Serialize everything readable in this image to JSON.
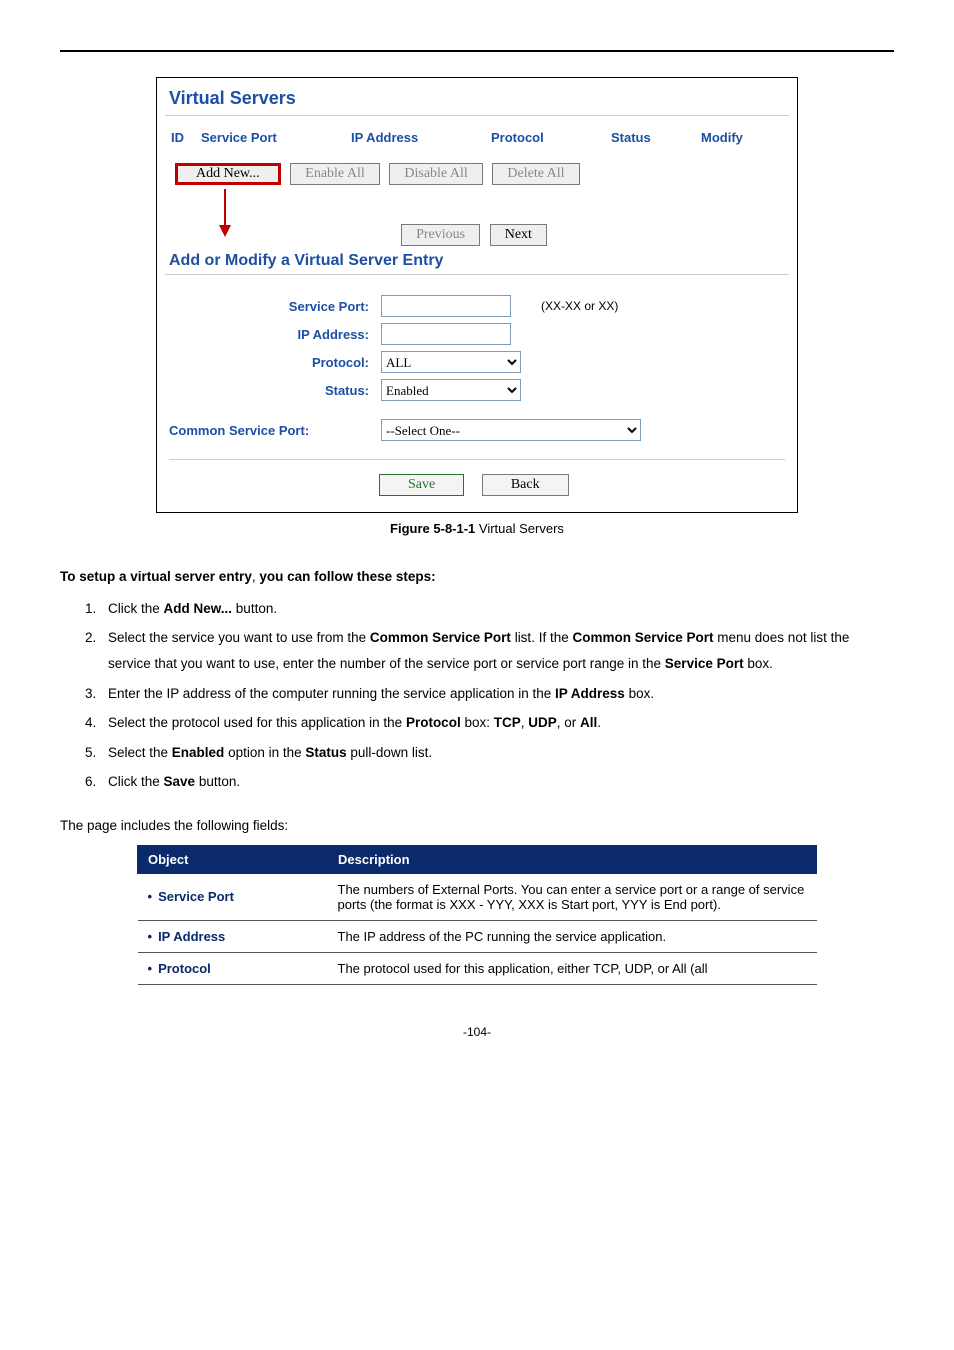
{
  "panel": {
    "title": "Virtual Servers",
    "columns": {
      "id": "ID",
      "service_port": "Service Port",
      "ip_address": "IP Address",
      "protocol": "Protocol",
      "status": "Status",
      "modify": "Modify"
    },
    "buttons": {
      "add_new": "Add New...",
      "enable_all": "Enable All",
      "disable_all": "Disable All",
      "delete_all": "Delete All",
      "previous": "Previous",
      "next": "Next"
    },
    "subheader": "Add or Modify a Virtual Server Entry",
    "form": {
      "service_port_label": "Service Port:",
      "service_port_hint": "(XX-XX or XX)",
      "ip_address_label": "IP Address:",
      "protocol_label": "Protocol:",
      "protocol_value": "ALL",
      "status_label": "Status:",
      "status_value": "Enabled",
      "csp_label": "Common Service Port:",
      "csp_value": "--Select One--",
      "save": "Save",
      "back": "Back"
    }
  },
  "caption": {
    "label": "Figure 5-8-1-1",
    "text": " Virtual Servers"
  },
  "intro": {
    "lead": "To setup a virtual server entry",
    "rest": ", you can follow these steps:"
  },
  "steps": [
    {
      "pre": "Click the ",
      "b1": "Add New...",
      "post": " button."
    },
    {
      "pre": "Select the service you want to use from the ",
      "b1": "Common Service Port",
      "mid": " list. If the ",
      "b2": "Common Service Port",
      "mid2": " menu does not list the service that you want to use, enter the number of the service port or service port range in the ",
      "b3": "Service Port",
      "post": " box."
    },
    {
      "pre": "Enter the IP address of the computer running the service application in the ",
      "b1": "IP Address",
      "post": " box."
    },
    {
      "pre": "Select the protocol used for this application in the ",
      "b1": "Protocol",
      "mid": " box: ",
      "b2": "TCP",
      "mid2": ", ",
      "b3": "UDP",
      "mid3": ", or ",
      "b4": "All",
      "post": "."
    },
    {
      "pre": "Select the ",
      "b1": "Enabled",
      "mid": " option in the ",
      "b2": "Status",
      "post": " pull-down list."
    },
    {
      "pre": "Click the ",
      "b1": "Save",
      "post": " button."
    }
  ],
  "fields_intro": "The page includes the following fields:",
  "table": {
    "head_object": "Object",
    "head_desc": "Description",
    "rows": [
      {
        "obj": "Service Port",
        "desc": "The numbers of External Ports. You can enter a service port or a range of service ports (the format is XXX - YYY, XXX is Start port, YYY is End port)."
      },
      {
        "obj": "IP Address",
        "desc": "The IP address of the PC running the service application."
      },
      {
        "obj": "Protocol",
        "desc": "The protocol used for this application, either TCP, UDP, or All (all"
      }
    ]
  },
  "footer": "-104-"
}
